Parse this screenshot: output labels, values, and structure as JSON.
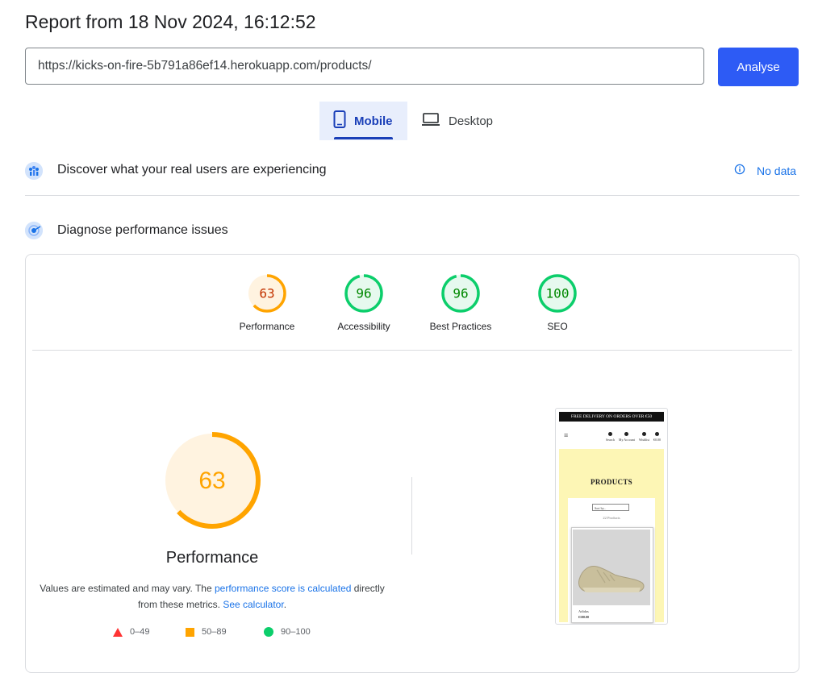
{
  "header": {
    "title": "Report from 18 Nov 2024, 16:12:52",
    "url_value": "https://kicks-on-fire-5b791a86ef14.herokuapp.com/products/",
    "analyse_label": "Analyse"
  },
  "tabs": [
    {
      "label": "Mobile",
      "selected": true,
      "icon": "phone-icon"
    },
    {
      "label": "Desktop",
      "selected": false,
      "icon": "laptop-icon"
    }
  ],
  "real_users": {
    "title": "Discover what your real users are experiencing",
    "status": "No data",
    "icon": "crux-icon",
    "status_icon": "info-icon"
  },
  "diagnose": {
    "title": "Diagnose performance issues",
    "icon": "lighthouse-icon"
  },
  "scores": [
    {
      "label": "Performance",
      "value": "63",
      "fraction": 0.63,
      "rating": "average"
    },
    {
      "label": "Accessibility",
      "value": "96",
      "fraction": 0.96,
      "rating": "pass"
    },
    {
      "label": "Best Practices",
      "value": "96",
      "fraction": 0.96,
      "rating": "pass"
    },
    {
      "label": "SEO",
      "value": "100",
      "fraction": 1.0,
      "rating": "pass"
    }
  ],
  "main_gauge": {
    "value": "63",
    "fraction": 0.63,
    "label": "Performance"
  },
  "note": {
    "prefix": "Values are estimated and may vary. The ",
    "link1": "performance score is calculated",
    "middle": " directly from these metrics. ",
    "link2": "See calculator",
    "suffix": "."
  },
  "legend": [
    {
      "range": "0–49",
      "shape": "triangle",
      "color": "#ff3333"
    },
    {
      "range": "50–89",
      "shape": "square",
      "color": "#ffa400"
    },
    {
      "range": "90–100",
      "shape": "circle",
      "color": "#0cce6b"
    }
  ],
  "colors": {
    "average_stroke": "#ffa400",
    "average_text": "#c33300",
    "average_fill": "#fff3e0",
    "pass_stroke": "#0cce6b",
    "pass_text": "#008800",
    "pass_fill": "#e6f9ee",
    "accent": "#2d5bf5",
    "link": "#1a73e8"
  },
  "phone_screenshot": {
    "banner": "FREE DELIVERY ON ORDERS OVER €50",
    "nav": [
      "Search",
      "My Account",
      "Wishlist",
      "€0.00"
    ],
    "heading": "PRODUCTS",
    "sort": "Sort by...",
    "count": "22 Products",
    "brand": "Adidas",
    "price": "€100.00"
  }
}
